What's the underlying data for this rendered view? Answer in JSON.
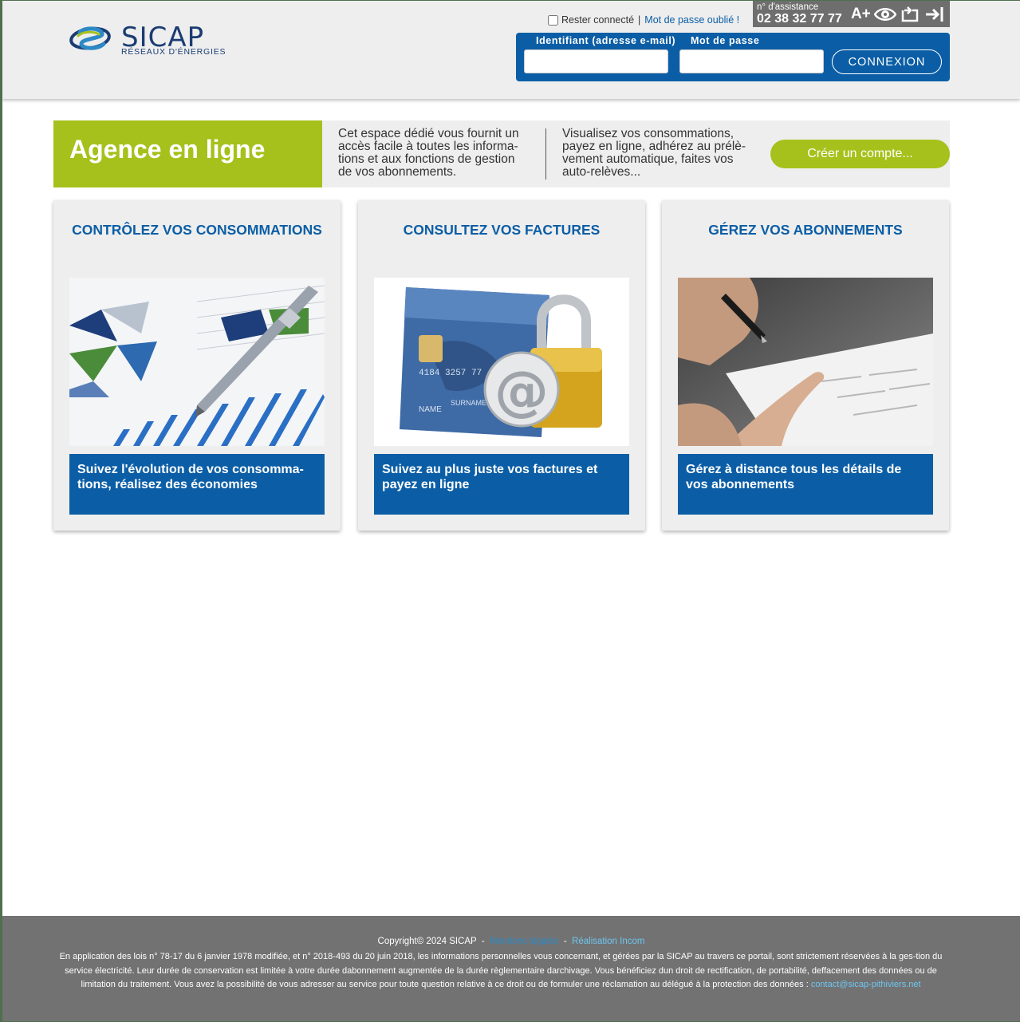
{
  "logo": {
    "name": "SICAP",
    "tagline": "RÉSEAUX D'ÉNERGIES"
  },
  "header": {
    "remember_label": "Rester connecté",
    "separator": "|",
    "forgot_label": "Mot de passe oublié !",
    "assistance_label": "n° d'assistance",
    "assistance_number": "02 38 32 77 77",
    "tools": [
      {
        "name": "font-size-icon",
        "glyph": "A+"
      },
      {
        "name": "eye-icon",
        "glyph": ""
      },
      {
        "name": "contrast-toggle-icon",
        "glyph": ""
      },
      {
        "name": "logout-icon",
        "glyph": ""
      }
    ]
  },
  "login": {
    "id_label": "Identifiant (adresse e-mail)",
    "password_label": "Mot de passe",
    "id_value": "",
    "password_value": "",
    "submit_label": "CONNEXION"
  },
  "banner": {
    "title": "Agence en ligne",
    "text1": "Cet espace dédié vous fournit un accès facile à toutes les informa-tions et aux fonctions de gestion de vos abonnements.",
    "text2": "Visualisez vos consommations, payez en ligne, adhérez au prélè-vement automatique, faites vos auto-relèves...",
    "create_label": "Créer un compte..."
  },
  "cards": [
    {
      "title": "CONTRÔLEZ VOS CONSOMMATIONS",
      "caption": "Suivez l'évolution de vos consomma-tions, réalisez des économies"
    },
    {
      "title": "CONSULTEZ VOS FACTURES",
      "caption": "Suivez au plus juste vos factures et payez en ligne"
    },
    {
      "title": "GÉREZ VOS ABONNEMENTS",
      "caption": "Gérez à distance tous les détails de vos abonnements"
    }
  ],
  "card_images": {
    "consumption_card_text": "4184 3257 77",
    "card_name": "NAME",
    "card_surname": "SURNAME",
    "at_symbol": "@"
  },
  "footer": {
    "copyright": "Copyright© 2024 SICAP",
    "dash": "-",
    "legal_link": "Mentions légales",
    "credit_link": "Réalisation Incom",
    "legal_text": "En application des lois n° 78-17 du 6 janvier 1978 modifiée, et n° 2018-493 du 20 juin 2018, les informations personnelles vous concernant, et gérées par la SICAP au travers ce portail, sont strictement réservées à la ges-tion du service électricité. Leur durée de conservation est limitée à votre durée dabonnement augmentée de la durée règlementaire darchivage. Vous bénéficiez dun droit de rectification, de portabilité, deffacement des données ou de limitation du traitement. Vous avez la possibilité de vous adresser au service pour toute question relative à ce droit ou de formuler une réclamation au délégué à la protection des données :",
    "contact_email": "contact@sicap-pithiviers.net"
  },
  "colors": {
    "brand_blue": "#0b5ea6",
    "brand_green": "#a6c11c",
    "panel_grey": "#eeeeee",
    "footer_grey": "#727272"
  }
}
